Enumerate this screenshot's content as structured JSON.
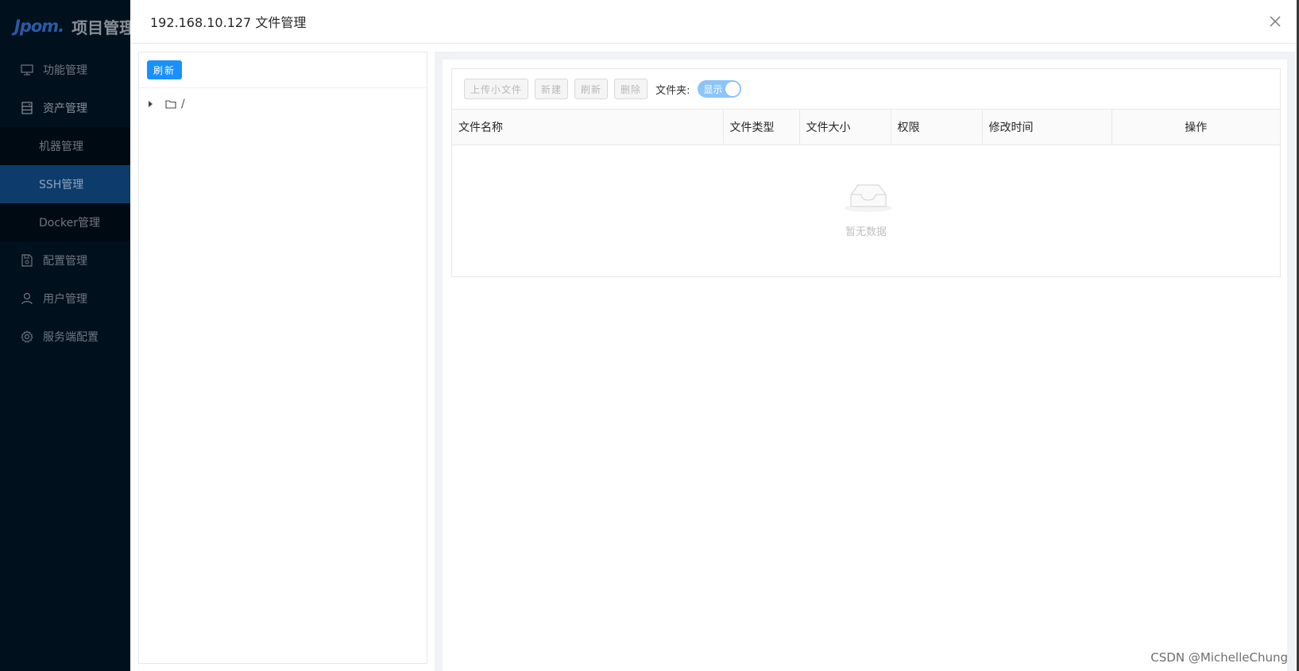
{
  "app": {
    "logo_mark": "Jpom.",
    "logo_text": "项目管理"
  },
  "sidebar": {
    "items": [
      {
        "label": "功能管理",
        "icon": "monitor-icon"
      },
      {
        "label": "资产管理",
        "icon": "server-icon"
      },
      {
        "label": "机器管理",
        "sub": true
      },
      {
        "label": "SSH管理",
        "sub": true,
        "active": true
      },
      {
        "label": "Docker管理",
        "sub": true
      },
      {
        "label": "配置管理",
        "icon": "save-icon"
      },
      {
        "label": "用户管理",
        "icon": "user-icon"
      },
      {
        "label": "服务端配置",
        "icon": "settings-icon"
      }
    ]
  },
  "modal": {
    "title": "192.168.10.127 文件管理",
    "close_icon": "close-icon"
  },
  "tree": {
    "refresh_label": "刷新",
    "root_label": "/"
  },
  "toolbar": {
    "upload_label": "上传小文件",
    "new_label": "新建",
    "refresh_label": "刷新",
    "delete_label": "删除",
    "folder_label": "文件夹:",
    "folder_switch_text": "显示",
    "folder_switch_on": true
  },
  "table": {
    "columns": [
      "文件名称",
      "文件类型",
      "文件大小",
      "权限",
      "修改时间",
      "操作"
    ],
    "rows": [],
    "empty_text": "暂无数据"
  },
  "watermark": "CSDN @MichelleChung",
  "colors": {
    "primary": "#1890ff",
    "sidebar_bg": "#00101d",
    "active_bg": "#0d3b6a"
  }
}
